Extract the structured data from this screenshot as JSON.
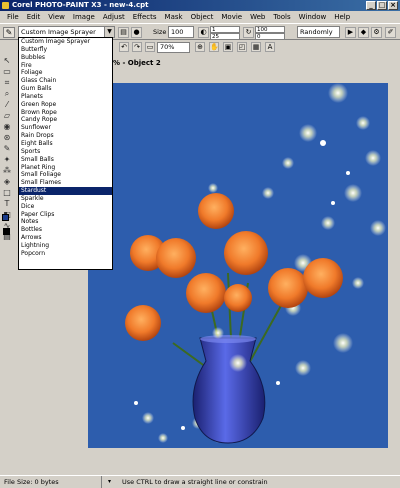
{
  "window": {
    "title": "Corel PHOTO-PAINT X3 - new-4.cpt",
    "controls": [
      "_",
      "□",
      "×"
    ]
  },
  "menu": [
    "File",
    "Edit",
    "View",
    "Image",
    "Adjust",
    "Effects",
    "Mask",
    "Object",
    "Movie",
    "Web",
    "Tools",
    "Window",
    "Help"
  ],
  "property_bar": {
    "sprayer_value": "Custom Image Sprayer",
    "size_label": "Size",
    "size_value": "100",
    "spin_a_top": "1",
    "spin_a_bottom": "25",
    "spin_b_top": "100",
    "spin_b_bottom": "0",
    "order_value": "Randomly"
  },
  "toolbar2": {
    "zoom_value": "70%"
  },
  "document": {
    "title_fragment": "% - Object 2"
  },
  "sprayer_list": {
    "selected": "Stardust",
    "items": [
      "Custom Image Sprayer",
      "Butterfly",
      "Bubbles",
      "Fire",
      "Foliage",
      "Glass Chain",
      "Gum Balls",
      "Planets",
      "Green Rope",
      "Brown Rope",
      "Candy Rope",
      "Sunflower",
      "Rain Drops",
      "Eight Balls",
      "Sports",
      "Small Balls",
      "Planet Ring",
      "Small Foliage",
      "Small Flames",
      "Stardust",
      "Sparkle",
      "Dice",
      "Paper Clips",
      "Notes",
      "Bottles",
      "Arrows",
      "Lightning",
      "Popcorn"
    ]
  },
  "status": {
    "file_size": "File Size: 0 bytes",
    "hint": "Use CTRL to draw a straight line or constrain"
  },
  "colors": {
    "canvas_bg": "#2d5dad",
    "selection": "#0a246a",
    "rose": "#f07a2a",
    "vase": "#3a4ac8"
  },
  "toolbox_icons": [
    "pick-tool-icon",
    "mask-tool-icon",
    "crop-tool-icon",
    "zoom-tool-icon",
    "eyedropper-tool-icon",
    "eraser-tool-icon",
    "redeye-tool-icon",
    "clone-tool-icon",
    "paint-tool-icon",
    "effect-tool-icon",
    "sprayer-tool-icon",
    "fill-tool-icon",
    "rectangle-tool-icon",
    "text-tool-icon",
    "interactive-tool-icon",
    "smear-tool-icon",
    "image-tool-icon"
  ]
}
